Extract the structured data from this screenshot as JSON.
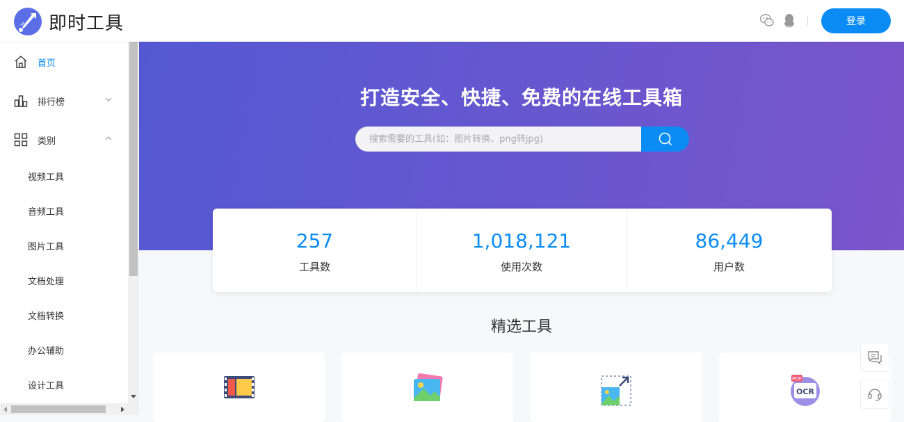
{
  "header": {
    "brand": "即时工具",
    "icons": [
      "wechat-icon",
      "qq-icon"
    ],
    "login_label": "登录"
  },
  "sidebar": {
    "items": [
      {
        "label": "首页",
        "icon": "home-icon",
        "active": true
      },
      {
        "label": "排行榜",
        "icon": "bar-chart-icon",
        "expanded": false
      },
      {
        "label": "类别",
        "icon": "grid-icon",
        "expanded": true
      }
    ],
    "sub_items": [
      "视频工具",
      "音频工具",
      "图片工具",
      "文档处理",
      "文档转换",
      "办公辅助",
      "设计工具"
    ]
  },
  "banner": {
    "slogan": "打造安全、快捷、免费的在线工具箱",
    "search_placeholder": "搜索需要的工具(如：图片转换、png转jpg)"
  },
  "stats": [
    {
      "value": "257",
      "label": "工具数"
    },
    {
      "value": "1,018,121",
      "label": "使用次数"
    },
    {
      "value": "86,449",
      "label": "用户数"
    }
  ],
  "featured": {
    "title": "精选工具",
    "cards": [
      "video-film-icon",
      "image-icon",
      "image-resize-icon",
      "pdf-ocr-icon"
    ]
  },
  "floating": [
    "feedback-icon",
    "customer-service-icon"
  ],
  "colors": {
    "accent": "#0b8cf5",
    "banner_start": "#5459d3",
    "banner_end": "#7a55cb"
  }
}
